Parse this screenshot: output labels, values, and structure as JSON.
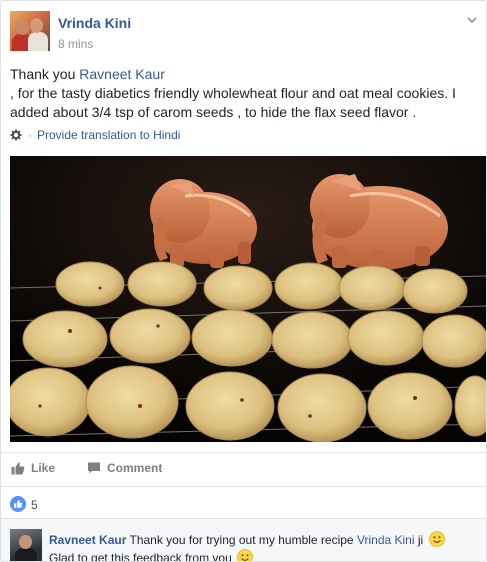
{
  "post": {
    "author": "Vrinda Kini",
    "timestamp": "8 mins",
    "text_intro": "Thank you ",
    "mention": "Ravneet Kaur",
    "text_body": ", for the tasty diabetics friendly wholewheat flour and oat meal cookies. I added about 3/4 tsp of carom seeds , to hide the flax seed flavor .",
    "translate_label": "Provide translation to Hindi",
    "translate_separator": "·"
  },
  "actions": {
    "like_label": "Like",
    "comment_label": "Comment"
  },
  "reactions": {
    "like_count": "5"
  },
  "comment": {
    "author": "Ravneet Kaur",
    "text_before": "Thank you for trying out my humble recipe ",
    "mention": "Vrinda Kini",
    "text_after": " ji",
    "line2": "Glad to get this feedback from you"
  },
  "icons": {
    "chevron": "chevron-down-icon",
    "gear": "gear-icon",
    "like": "thumbs-up-icon",
    "comment": "comment-bubble-icon",
    "emoji": "smile-emoji-icon"
  },
  "colors": {
    "link": "#365899",
    "like_badge": "#5890ff",
    "muted": "#90949c"
  }
}
